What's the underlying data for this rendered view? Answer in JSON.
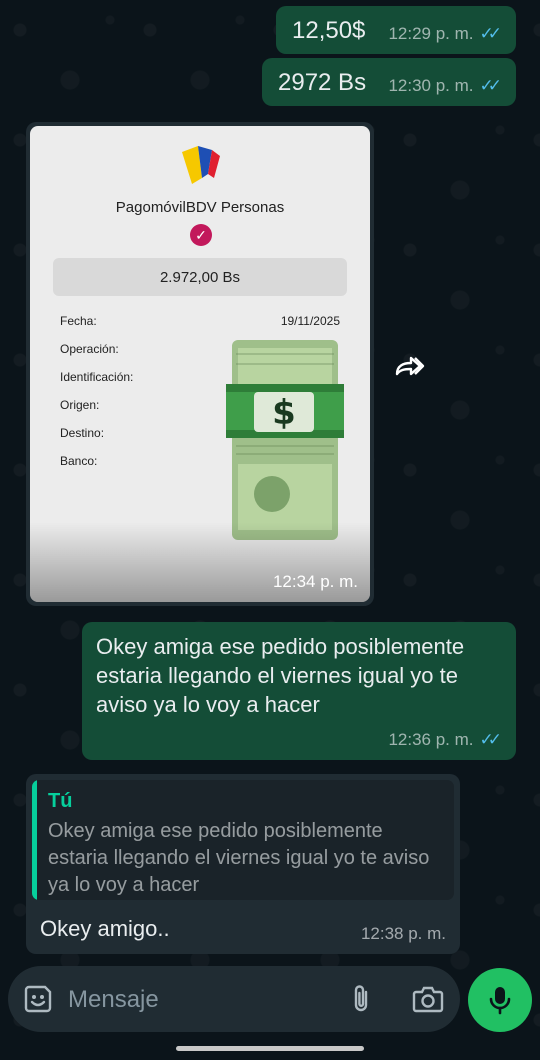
{
  "messages": {
    "m1": {
      "text": "12,50$",
      "time": "12:29 p. m."
    },
    "m2": {
      "text": "2972 Bs",
      "time": "12:30 p. m."
    },
    "image_msg": {
      "time": "12:34 p. m.",
      "receipt": {
        "title": "PagomóvilBDV Personas",
        "amount": "2.972,00 Bs",
        "fields": [
          {
            "label": "Fecha:",
            "value": "19/11/2025"
          },
          {
            "label": "Operación:",
            "value": ""
          },
          {
            "label": "Identificación:",
            "value": ""
          },
          {
            "label": "Origen:",
            "value": ""
          },
          {
            "label": "Destino:",
            "value": ""
          },
          {
            "label": "Banco:",
            "value": ""
          }
        ],
        "sticker_icon": "money-bag-icon"
      }
    },
    "m3": {
      "text": "Okey amiga ese pedido posiblemente estaria llegando el viernes igual yo te aviso ya lo voy a hacer",
      "time": "12:36 p. m."
    },
    "m4": {
      "quote_author": "Tú",
      "quote_text": "Okey amiga ese pedido posiblemente estaria llegando el viernes igual yo te aviso ya lo voy a hacer",
      "text": "Okey amigo..",
      "time": "12:38 p. m."
    }
  },
  "composer": {
    "placeholder": "Mensaje"
  },
  "colors": {
    "background": "#0b141a",
    "outgoing_bubble": "#144d37",
    "incoming_bubble": "#202c33",
    "read_ticks": "#53bdeb",
    "accent": "#21c063",
    "quote_accent": "#06cf9c"
  }
}
